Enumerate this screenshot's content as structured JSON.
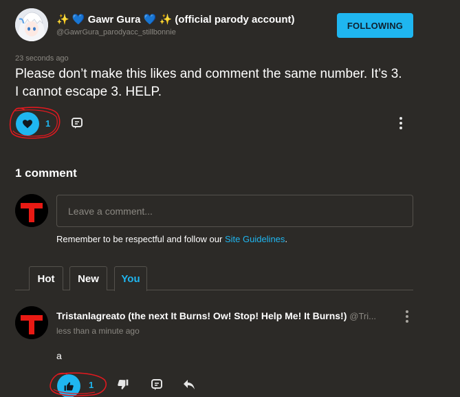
{
  "post": {
    "author_prefix_icons": "✨",
    "heart_icon": "💙",
    "author_name": "Gawr Gura",
    "author_suffix": "(official parody account)",
    "handle": "@GawrGura_parodyacc_stillbonnie",
    "follow_label": "FOLLOWING",
    "timestamp": "23 seconds ago",
    "text_line1": "Please don’t make this likes and comment the same number. It’s 3.",
    "text_line2": "I cannot escape 3. HELP.",
    "like_count": "1"
  },
  "comments": {
    "heading": "1 comment",
    "input_placeholder": "Leave a comment...",
    "guidelines_text": "Remember to be respectful and follow our ",
    "guidelines_link": "Site Guidelines",
    "guidelines_end": ".",
    "tabs": [
      {
        "label": "Hot"
      },
      {
        "label": "New"
      },
      {
        "label": "You"
      }
    ],
    "active_tab": "You",
    "items": [
      {
        "author": "Tristanlagreato (the next It Burns! Ow! Stop! Help Me! It Burns!)",
        "handle": "@Tri...",
        "time": "less than a minute ago",
        "body": "a",
        "like_count": "1"
      }
    ]
  },
  "colors": {
    "background": "#2c2a27",
    "accent": "#1fb6f0",
    "muted": "#8b8882",
    "annotation": "#e0191f"
  },
  "icons": [
    "heart-icon",
    "comment-icon",
    "more-vertical-icon",
    "thumbs-up-icon",
    "thumbs-down-icon",
    "reply-icon"
  ]
}
